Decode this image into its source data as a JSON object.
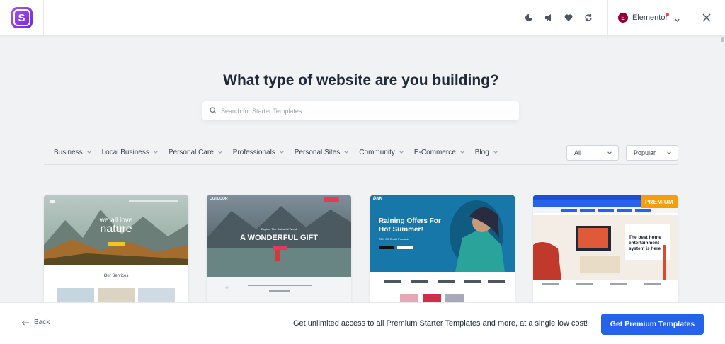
{
  "header": {
    "builder_label": "Elementor",
    "builder_badge": "E",
    "logo_letter": "S",
    "icons": [
      "pie-chart-icon",
      "megaphone-icon",
      "heart-icon",
      "sync-icon"
    ]
  },
  "main": {
    "title": "What type of website are you building?",
    "search": {
      "placeholder": "Search for Starter Templates",
      "value": ""
    },
    "categories": [
      "Business",
      "Local Business",
      "Personal Care",
      "Professionals",
      "Personal Sites",
      "Community",
      "E-Commerce",
      "Blog"
    ],
    "filters": {
      "type": "All",
      "sort": "Popular"
    }
  },
  "templates": [
    {
      "hero_line1": "we all love",
      "hero_line2": "nature",
      "section": "Our Services"
    },
    {
      "brand": "OUTDOOR",
      "kicker": "Explore The Colourful World",
      "hero": "A WONDERFUL GIFT"
    },
    {
      "brand": "DNK",
      "hero": "Raining Offers For Hot Summer!",
      "sub": "25% Off On All Products"
    },
    {
      "badge": "PREMIUM",
      "hero": "The best home entertainment system is here"
    }
  ],
  "footer": {
    "back_label": "Back",
    "promo_text": "Get unlimited access to all Premium Starter Templates and more, at a single low cost!",
    "cta_label": "Get Premium Templates"
  },
  "colors": {
    "accent": "#2563eb",
    "premium": "#f59e0b",
    "logo": "#7c3aed",
    "elementor": "#92003b"
  }
}
